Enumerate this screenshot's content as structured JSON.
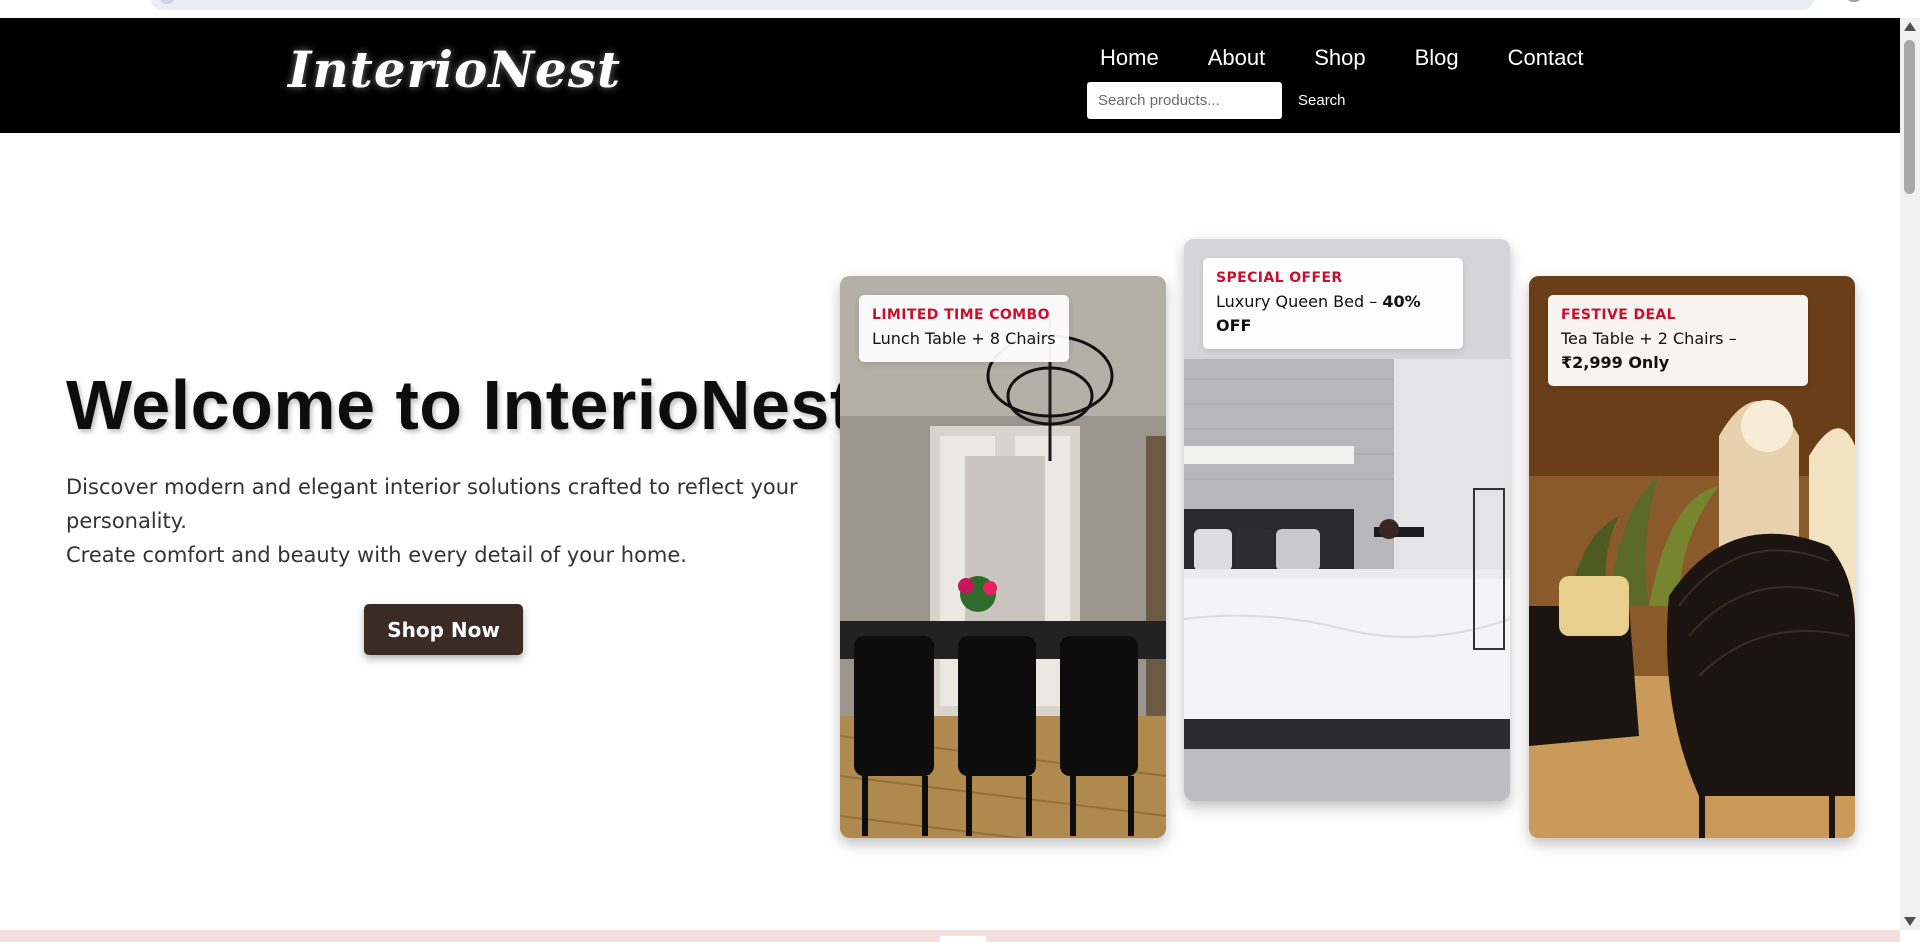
{
  "brand": {
    "logo_text": "InterioNest"
  },
  "nav": {
    "items": [
      {
        "label": "Home"
      },
      {
        "label": "About"
      },
      {
        "label": "Shop"
      },
      {
        "label": "Blog"
      },
      {
        "label": "Contact"
      }
    ]
  },
  "search": {
    "placeholder": "Search products...",
    "value": "",
    "button_label": "Search"
  },
  "hero": {
    "title": "Welcome to InterioNest",
    "desc_line1": "Discover modern and elegant interior solutions crafted to reflect your personality.",
    "desc_line2": "Create comfort and beauty with every detail of your home.",
    "cta_label": "Shop Now"
  },
  "offers": [
    {
      "tag": "LIMITED TIME COMBO",
      "text": "Lunch Table + 8 Chairs",
      "highlight": ""
    },
    {
      "tag": "SPECIAL OFFER",
      "text": "Luxury Queen Bed – ",
      "highlight": "40% OFF"
    },
    {
      "tag": "FESTIVE DEAL",
      "text": "Tea Table + 2 Chairs – ",
      "highlight": "₹2,999 Only"
    }
  ],
  "colors": {
    "header_bg": "#000000",
    "accent_red": "#c8102e",
    "cta_bg": "#3a2b25"
  }
}
